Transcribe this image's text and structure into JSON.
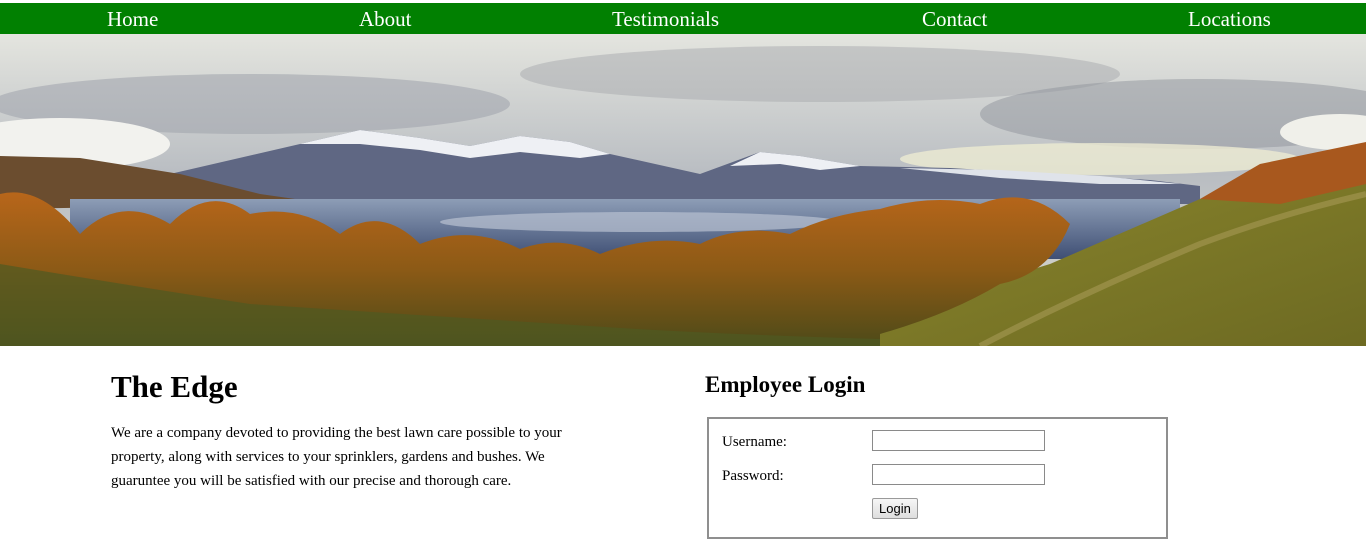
{
  "nav": {
    "items": [
      "Home",
      "About",
      "Testimonials",
      "Contact",
      "Locations"
    ]
  },
  "hero": {
    "image": "panoramic landscape photo — snow-capped mountains, lake, autumn trees",
    "colors": {
      "nav_bg": "#018001",
      "nav_text": "#ffffff"
    }
  },
  "intro": {
    "title": "The Edge",
    "description": "We are a company devoted to providing the best lawn care possible to your property, along with services to your sprinklers, gardens and bushes. We guaruntee you will be satisfied with our precise and thorough care."
  },
  "login": {
    "title": "Employee Login",
    "username_label": "Username:",
    "username_value": "",
    "password_label": "Password:",
    "password_value": "",
    "button_label": "Login"
  }
}
